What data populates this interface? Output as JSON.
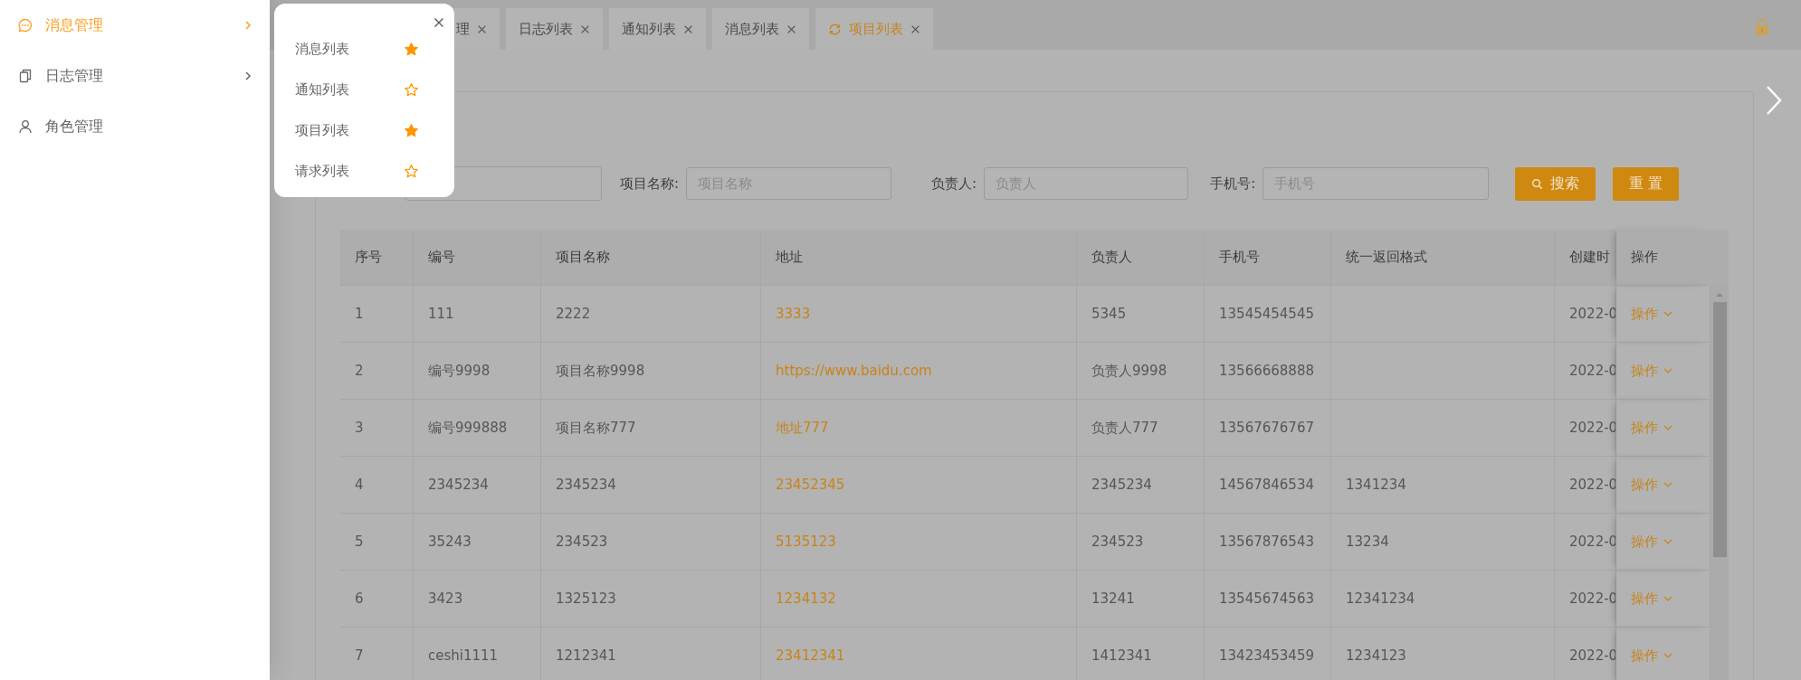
{
  "sidebar": {
    "items": [
      {
        "label": "消息管理",
        "kind": "chat",
        "selected": true,
        "expandable": true
      },
      {
        "label": "日志管理",
        "kind": "files",
        "selected": false,
        "expandable": true
      },
      {
        "label": "角色管理",
        "kind": "user",
        "selected": false,
        "expandable": false
      }
    ]
  },
  "favorites_popup": {
    "items": [
      {
        "label": "消息列表",
        "starred": true
      },
      {
        "label": "通知列表",
        "starred": false
      },
      {
        "label": "项目列表",
        "starred": true
      },
      {
        "label": "请求列表",
        "starred": false
      }
    ]
  },
  "tabs": [
    {
      "label": "理",
      "selected": false
    },
    {
      "label": "日志列表",
      "selected": false
    },
    {
      "label": "通知列表",
      "selected": false
    },
    {
      "label": "消息列表",
      "selected": false
    },
    {
      "label": "项目列表",
      "selected": true
    }
  ],
  "search": {
    "fields": [
      {
        "label": "项目名称:",
        "placeholder": "项目名称"
      },
      {
        "label": "负责人:",
        "placeholder": "负责人"
      },
      {
        "label": "手机号:",
        "placeholder": "手机号"
      }
    ],
    "buttons": [
      {
        "label": "搜索",
        "kind": "search"
      },
      {
        "label": "重 置",
        "kind": "reset"
      }
    ]
  },
  "table": {
    "columns": [
      "序号",
      "编号",
      "项目名称",
      "地址",
      "负责人",
      "手机号",
      "统一返回格式",
      "创建时",
      "操作"
    ],
    "rows": [
      {
        "cells": [
          "1",
          "111",
          "2222",
          "3333",
          "5345",
          "13545454545",
          "",
          "2022-0"
        ],
        "action": "操作"
      },
      {
        "cells": [
          "2",
          "编号9998",
          "项目名称9998",
          "https://www.baidu.com",
          "负责人9998",
          "13566668888",
          "",
          "2022-0"
        ],
        "action": "操作"
      },
      {
        "cells": [
          "3",
          "编号999888",
          "项目名称777",
          "地址777",
          "负责人777",
          "13567676767",
          "",
          "2022-0"
        ],
        "action": "操作"
      },
      {
        "cells": [
          "4",
          "2345234",
          "2345234",
          "23452345",
          "2345234",
          "14567846534",
          "1341234",
          "2022-0"
        ],
        "action": "操作"
      },
      {
        "cells": [
          "5",
          "35243",
          "234523",
          "5135123",
          "234523",
          "13567876543",
          "13234",
          "2022-0"
        ],
        "action": "操作"
      },
      {
        "cells": [
          "6",
          "3423",
          "1325123",
          "1234132",
          "13241",
          "13545674563",
          "12341234",
          "2022-0"
        ],
        "action": "操作"
      },
      {
        "cells": [
          "7",
          "ceshi1111",
          "1212341",
          "23412341",
          "1412341",
          "13423453459",
          "1234123",
          "2022-0"
        ],
        "action": "操作"
      }
    ]
  }
}
